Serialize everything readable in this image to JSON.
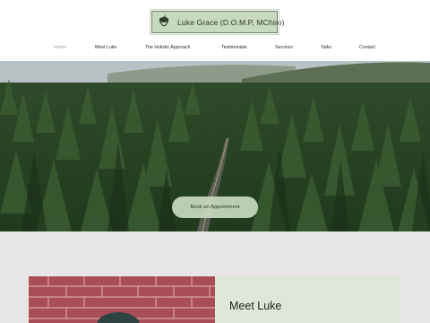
{
  "header": {
    "logo_text": "Luke Grace (D.O.M.P, MChiro)",
    "logo_icon": "acorn-icon"
  },
  "nav": {
    "items": [
      {
        "label": "Home",
        "active": true
      },
      {
        "label": "Meet Luke",
        "active": false
      },
      {
        "label": "The Holistic Approach",
        "active": false
      },
      {
        "label": "Testimonials",
        "active": false
      },
      {
        "label": "Services",
        "active": false
      },
      {
        "label": "Talks",
        "active": false
      },
      {
        "label": "Contact",
        "active": false
      }
    ]
  },
  "hero": {
    "cta_label": "Book an Appointment"
  },
  "about": {
    "title": "Meet Luke"
  },
  "colors": {
    "accent": "#c7d9be",
    "active_nav": "#8da88a",
    "band": "#e8e6e6",
    "card": "#dfe8d8"
  }
}
